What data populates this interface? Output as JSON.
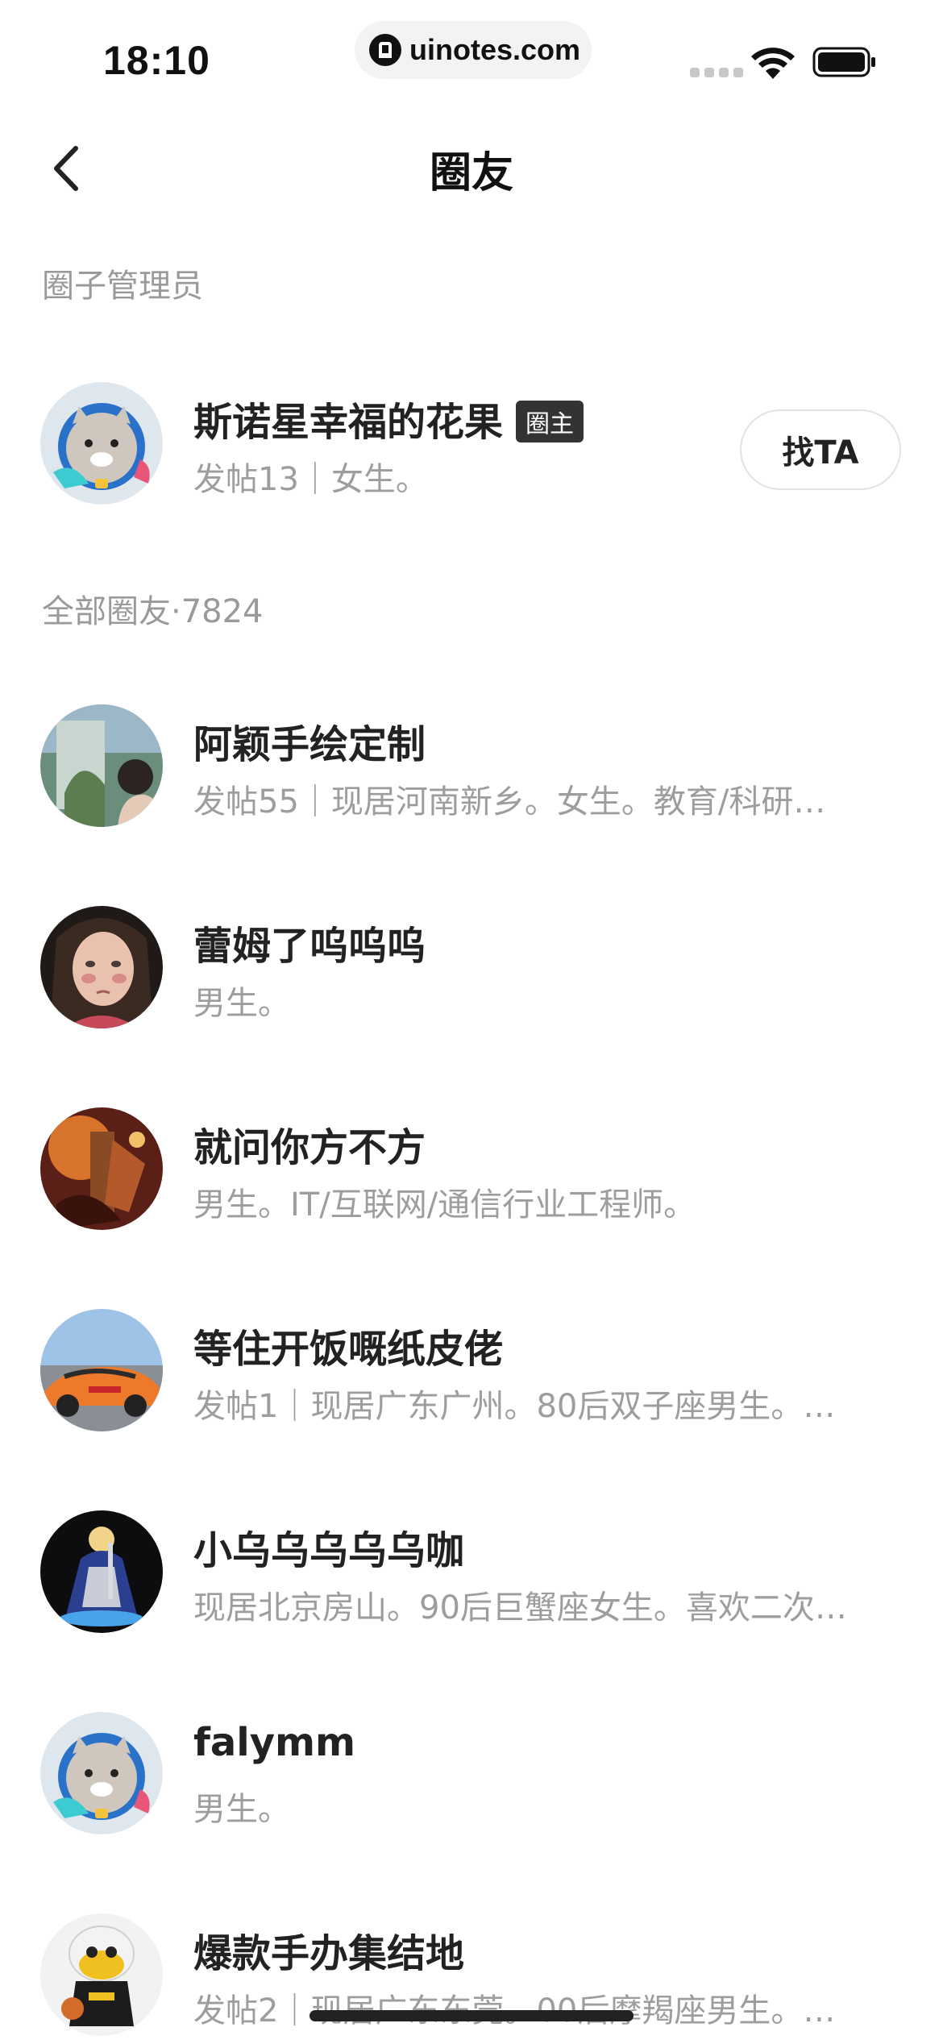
{
  "status_bar": {
    "time": "18:10",
    "url": "uinotes.com",
    "icons": [
      "signal-icon",
      "wifi-icon",
      "battery-icon"
    ]
  },
  "nav": {
    "title": "圈友",
    "back_icon": "chevron-left-icon"
  },
  "admins": {
    "header": "圈子管理员",
    "items": [
      {
        "name": "斯诺星幸福的花果",
        "badge": "圈主",
        "desc": "发帖13｜女生。",
        "action": "找TA",
        "avatar": "cat-astronaut"
      }
    ]
  },
  "members": {
    "header": "全部圈友·7824",
    "items": [
      {
        "name": "阿颖手绘定制",
        "desc": "发帖55｜现居河南新乡。女生。教育/科研…",
        "avatar": "painting-girl"
      },
      {
        "name": "蕾姆了呜呜呜",
        "desc": "男生。",
        "avatar": "crying-girl"
      },
      {
        "name": "就问你方不方",
        "desc": "男生。IT/互联网/通信行业工程师。",
        "avatar": "dark-fantasy"
      },
      {
        "name": "等住开饭嘅纸皮佬",
        "desc": "发帖1｜现居广东广州。80后双子座男生。…",
        "avatar": "race-car"
      },
      {
        "name": "小乌乌乌乌乌咖",
        "desc": "现居北京房山。90后巨蟹座女生。喜欢二次…",
        "avatar": "anime-knight"
      },
      {
        "name": "falymm",
        "desc": "男生。",
        "avatar": "cat-astronaut"
      },
      {
        "name": "爆款手办集结地",
        "desc": "发帖2｜现居广东东莞。00后摩羯座男生。…",
        "avatar": "figure-toy"
      }
    ]
  }
}
